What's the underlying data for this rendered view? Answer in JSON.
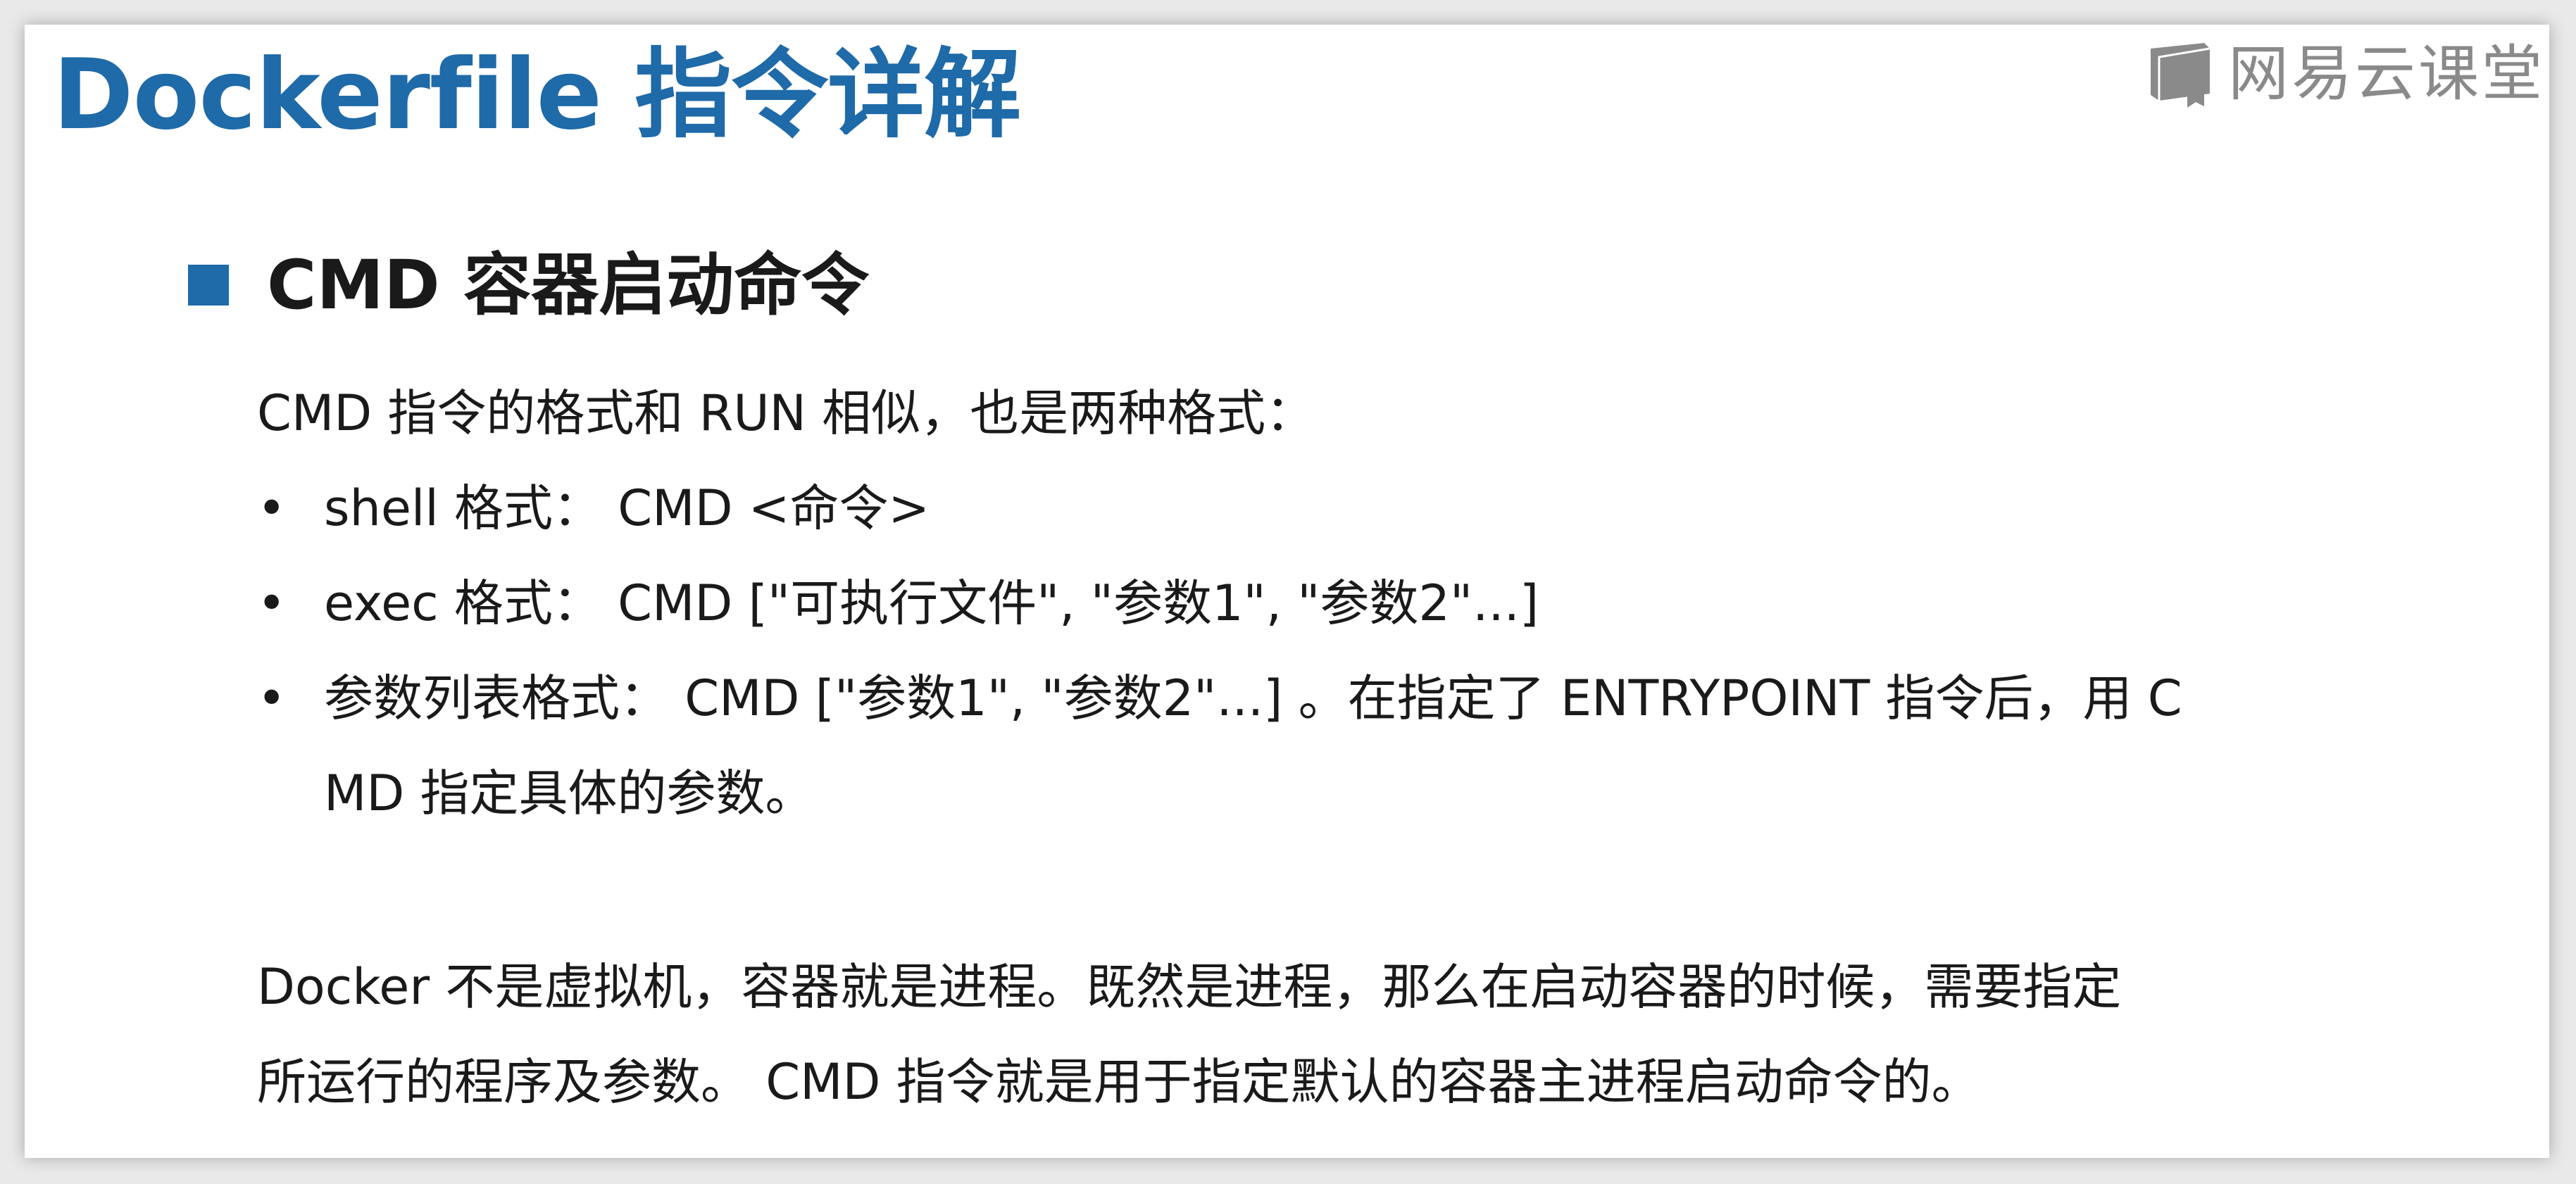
{
  "slide": {
    "title": "Dockerfile 指令详解",
    "brand": {
      "icon": "book-logo-icon",
      "text": "网易云课堂"
    },
    "section": {
      "marker": "square-bullet-icon",
      "title": "CMD 容器启动命令"
    },
    "intro": "CMD 指令的格式和 RUN 相似，也是两种格式：",
    "bullets": [
      {
        "marker": "•",
        "lines": [
          "shell 格式： CMD <命令>"
        ]
      },
      {
        "marker": "•",
        "lines": [
          "exec 格式： CMD [\"可执行文件\", \"参数1\", \"参数2\"...]"
        ]
      },
      {
        "marker": "•",
        "lines": [
          "参数列表格式： CMD [\"参数1\", \"参数2\"...] 。在指定了 ENTRYPOINT 指令后，用 C",
          "MD 指定具体的参数。"
        ]
      }
    ],
    "closing": [
      "Docker 不是虚拟机，容器就是进程。既然是进程，那么在启动容器的时候，需要指定",
      "所运行的程序及参数。 CMD 指令就是用于指定默认的容器主进程启动命令的。"
    ],
    "colors": {
      "title": "#1f6aa8",
      "accent": "#1f6aa8",
      "body_text": "#1a1a1a",
      "brand": "#8a8a8a"
    }
  }
}
